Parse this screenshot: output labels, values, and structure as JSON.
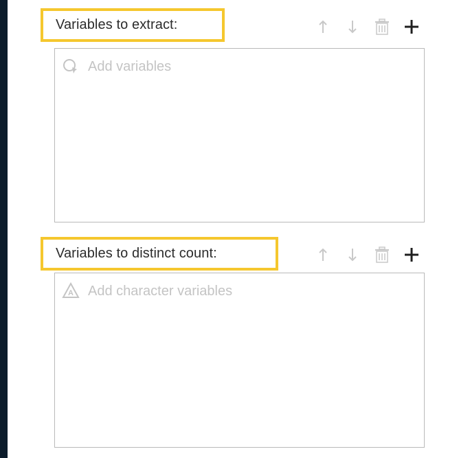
{
  "sections": [
    {
      "label": "Variables to extract:",
      "placeholder": "Add variables",
      "placeholder_icon": "variable-search-icon",
      "toolbar": [
        "move-up-icon",
        "move-down-icon",
        "delete-icon",
        "add-icon"
      ]
    },
    {
      "label": "Variables to distinct count:",
      "placeholder": "Add character variables",
      "placeholder_icon": "character-variable-icon",
      "toolbar": [
        "move-up-icon",
        "move-down-icon",
        "delete-icon",
        "add-icon"
      ]
    }
  ],
  "colors": {
    "highlight_border": "#f5c72e",
    "disabled_icon": "#c8c8c8",
    "active_icon": "#1f1f1f",
    "placeholder_text": "#c4c4c4",
    "background_dark": "#0c1c2b"
  }
}
